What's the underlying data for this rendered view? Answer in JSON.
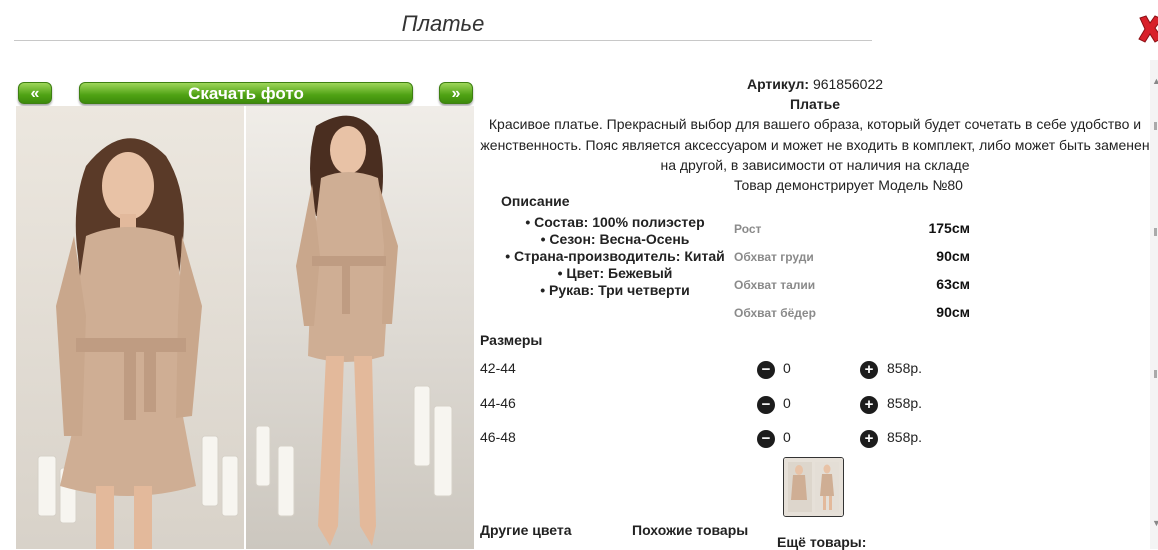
{
  "window": {
    "title": "Платье",
    "close_icon": "close-icon"
  },
  "gallery": {
    "prev_label": "«",
    "download_label": "Скачать фото",
    "next_label": "»"
  },
  "product": {
    "article_label": "Артикул:",
    "article_value": "961856022",
    "name": "Платье",
    "description": "Красивое платье. Прекрасный выбор для вашего образа, который будет сочетать в себе удобство и женственность. Пояс является аксессуаром и может не входить в комплект, либо может быть заменен на другой, в зависимости от наличия на складе",
    "model_note": "Товар демонстрирует Модель №80"
  },
  "specs": {
    "title": "Описание",
    "items": [
      "Состав: 100% полиэстер",
      "Сезон: Весна-Осень",
      "Страна-производитель: Китай",
      "Цвет: Бежевый",
      "Рукав: Три четверти"
    ]
  },
  "measurements": [
    {
      "label": "Рост",
      "value": "175см"
    },
    {
      "label": "Обхват груди",
      "value": "90см"
    },
    {
      "label": "Обхват талии",
      "value": "63см"
    },
    {
      "label": "Обхват бёдер",
      "value": "90см"
    }
  ],
  "sizes": {
    "title": "Размеры",
    "rows": [
      {
        "label": "42-44",
        "qty": "0",
        "price": "858р."
      },
      {
        "label": "44-46",
        "qty": "0",
        "price": "858р."
      },
      {
        "label": "46-48",
        "qty": "0",
        "price": "858р."
      }
    ]
  },
  "footer": {
    "other_colors": "Другие цвета",
    "similar": "Похожие товары",
    "more": "Ещё товары:"
  }
}
